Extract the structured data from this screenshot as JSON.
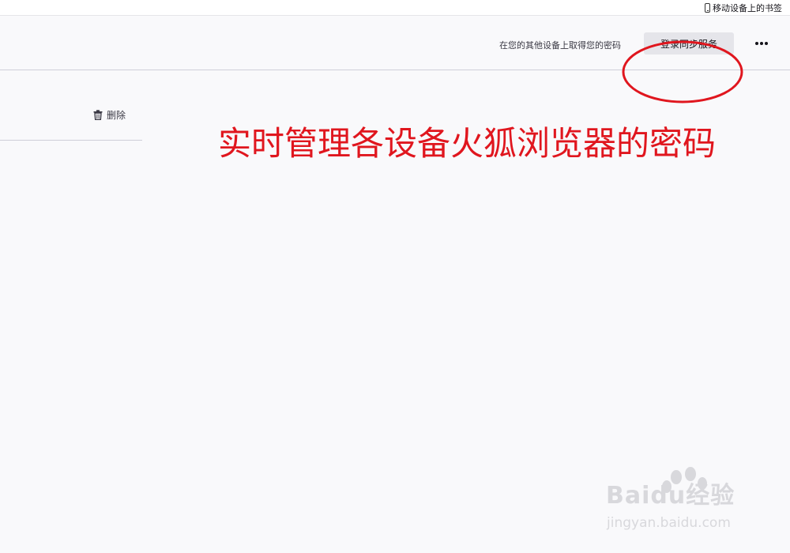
{
  "bookmarks_bar": {
    "mobile_bookmarks_label": "移动设备上的书签",
    "mobile_icon": "phone-icon"
  },
  "header": {
    "sync_prompt": "在您的其他设备上取得您的密码",
    "sync_button_label": "登录同步服务",
    "more_icon": "more-icon"
  },
  "list_pane": {
    "delete_label": "删除",
    "delete_icon": "trash-icon"
  },
  "annotation": {
    "caption": "实时管理各设备火狐浏览器的密码",
    "color": "#e0161e"
  },
  "watermark": {
    "main": "Baidu经验",
    "sub": "jingyan.baidu.com"
  }
}
